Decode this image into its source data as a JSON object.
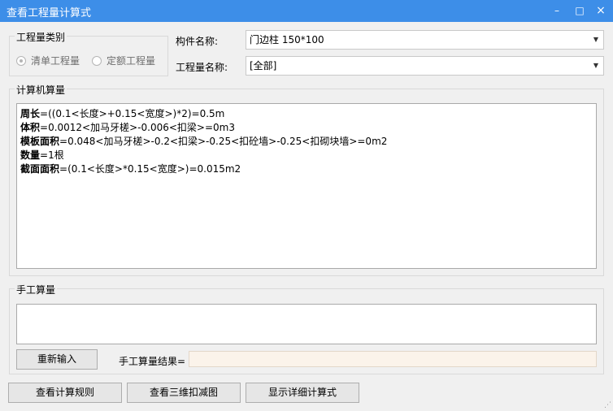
{
  "window": {
    "title": "查看工程量计算式",
    "minimize_glyph": "–",
    "maximize_glyph": "□",
    "close_glyph": "×"
  },
  "quantity_category": {
    "group_label": "工程量类别",
    "options": [
      {
        "label": "清单工程量",
        "selected": true
      },
      {
        "label": "定额工程量",
        "selected": false
      }
    ]
  },
  "component_name": {
    "label": "构件名称:",
    "value": "门边柱 150*100"
  },
  "quantity_name": {
    "label": "工程量名称:",
    "value": "[全部]"
  },
  "computer_calc": {
    "group_label": "计算机算量",
    "lines": [
      {
        "name": "周长",
        "expr": "=((0.1<长度>+0.15<宽度>)*2)=0.5m"
      },
      {
        "name": "体积",
        "expr": "=0.0012<加马牙槎>-0.006<扣梁>=0m3"
      },
      {
        "name": "模板面积",
        "expr": "=0.048<加马牙槎>-0.2<扣梁>-0.25<扣砼墙>-0.25<扣砌块墙>=0m2"
      },
      {
        "name": "数量",
        "expr": "=1根"
      },
      {
        "name": "截面面积",
        "expr": "=(0.1<长度>*0.15<宽度>)=0.015m2"
      }
    ]
  },
  "manual_calc": {
    "group_label": "手工算量",
    "reenter_button": "重新输入",
    "result_label": "手工算量结果=",
    "result_value": ""
  },
  "bottom_buttons": {
    "view_rules": "查看计算规则",
    "view_3d": "查看三维扣减图",
    "show_detail": "显示详细计算式"
  },
  "icons": {
    "dropdown": "▼",
    "resize_grip": "⋰"
  }
}
